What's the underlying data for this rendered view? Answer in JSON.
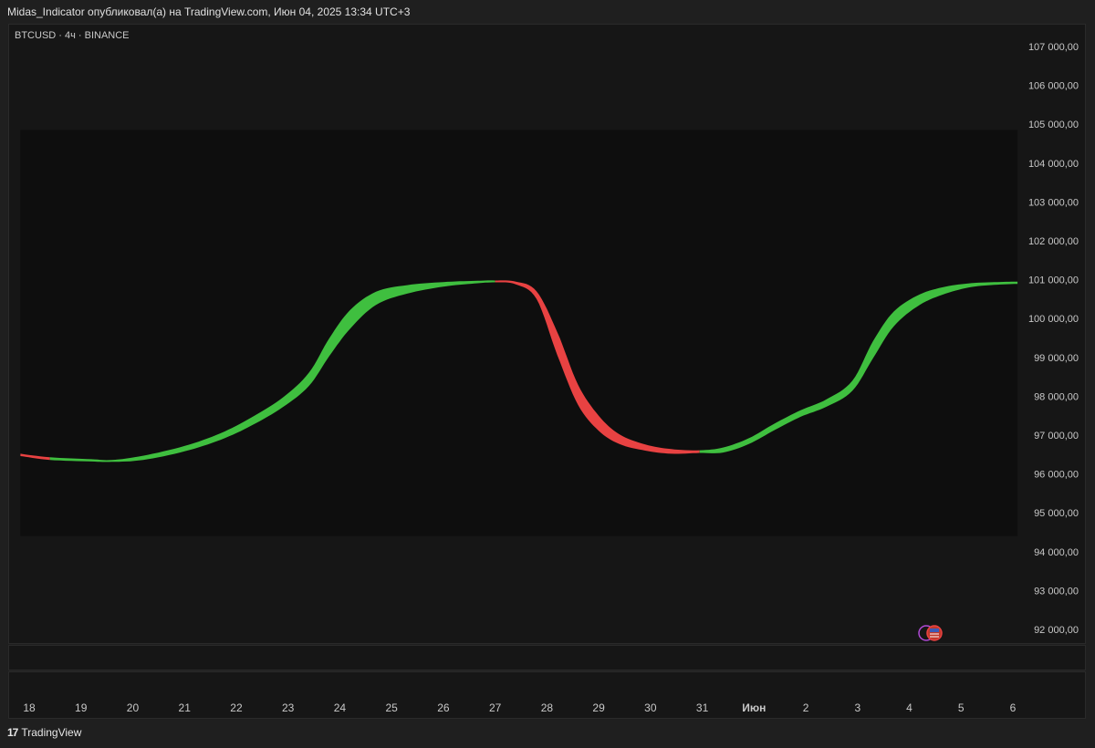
{
  "header": {
    "publisher_line": "Midas_Indicator опубликовал(а) на TradingView.com, Июн 04, 2025 13:34 UTC+3"
  },
  "symbol": {
    "label": "BTCUSD · 4ч · BINANCE"
  },
  "footer": {
    "brand_logo": "17",
    "brand_name": "TradingView"
  },
  "events": {
    "icon": "us-flag-icon"
  },
  "colors": {
    "bull": "#3fbf3f",
    "bear": "#e84242",
    "plot_bg": "#0e0e0e"
  },
  "chart_data": {
    "type": "area",
    "title": "",
    "ylabel": "",
    "ylim": [
      91600,
      107500
    ],
    "y_ticks": [
      "107 000,00",
      "106 000,00",
      "105 000,00",
      "104 000,00",
      "103 000,00",
      "102 000,00",
      "101 000,00",
      "100 000,00",
      "99 000,00",
      "98 000,00",
      "97 000,00",
      "96 000,00",
      "95 000,00",
      "94 000,00",
      "93 000,00",
      "92 000,00"
    ],
    "y_tick_values": [
      107000,
      106000,
      105000,
      104000,
      103000,
      102000,
      101000,
      100000,
      99000,
      98000,
      97000,
      96000,
      95000,
      94000,
      93000,
      92000
    ],
    "x_ticks": [
      "18",
      "19",
      "20",
      "21",
      "22",
      "23",
      "24",
      "25",
      "26",
      "27",
      "28",
      "29",
      "30",
      "31",
      "Июн",
      "2",
      "3",
      "4",
      "5",
      "6"
    ],
    "x_tick_values": [
      18,
      19,
      20,
      21,
      22,
      23,
      24,
      25,
      26,
      27,
      28,
      29,
      30,
      31,
      32,
      33,
      34,
      35,
      36,
      37
    ],
    "bold_x_tick": "Июн",
    "xlim": [
      17.83,
      37.18
    ],
    "band_x_range": [
      17.83,
      37.09
    ],
    "band_y_range": [
      94400,
      104850
    ],
    "series": [
      {
        "x": [
          17.83,
          18.4,
          19.2,
          19.6,
          20.2,
          21.0,
          21.7,
          22.3,
          22.9,
          23.4,
          23.8,
          24.2,
          24.7,
          25.3,
          26.0,
          26.6,
          27.0,
          27.4,
          27.8,
          28.2,
          28.6,
          29.0,
          29.4,
          29.9,
          30.4,
          30.95,
          31.4,
          31.9,
          32.4,
          32.9,
          33.4,
          33.9,
          34.3,
          34.7,
          35.2,
          35.7,
          36.2,
          36.7,
          37.09
        ],
        "upper": [
          96520,
          96430,
          96380,
          96360,
          96470,
          96720,
          97050,
          97460,
          97970,
          98600,
          99500,
          100220,
          100690,
          100860,
          100940,
          100970,
          100980,
          100950,
          100700,
          99650,
          98300,
          97500,
          97020,
          96760,
          96640,
          96610,
          96680,
          96920,
          97300,
          97640,
          97920,
          98400,
          99420,
          100180,
          100620,
          100820,
          100910,
          100940,
          100950
        ],
        "lower": [
          96480,
          96380,
          96340,
          96330,
          96380,
          96600,
          96900,
          97270,
          97740,
          98280,
          99060,
          99760,
          100370,
          100660,
          100840,
          100920,
          100950,
          100900,
          100520,
          99080,
          97800,
          97130,
          96790,
          96620,
          96540,
          96560,
          96570,
          96790,
          97150,
          97490,
          97750,
          98160,
          99000,
          99820,
          100370,
          100660,
          100830,
          100890,
          100910
        ],
        "signal": [
          "bear",
          "bull",
          "bull",
          "bull",
          "bull",
          "bull",
          "bull",
          "bull",
          "bull",
          "bull",
          "bull",
          "bull",
          "bull",
          "bull",
          "bull",
          "bull",
          "bull",
          "bear",
          "bear",
          "bear",
          "bear",
          "bear",
          "bear",
          "bear",
          "bear",
          "bear",
          "bull",
          "bull",
          "bull",
          "bull",
          "bull",
          "bull",
          "bull",
          "bull",
          "bull",
          "bull",
          "bull",
          "bull",
          "bull"
        ]
      }
    ]
  }
}
